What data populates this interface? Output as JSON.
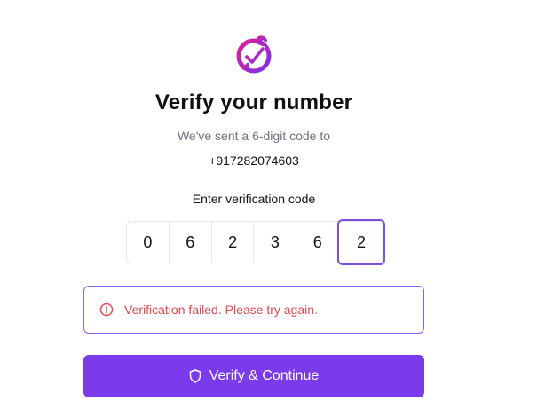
{
  "header": {
    "logo_icon": "wrench-check-logo-icon",
    "title": "Verify your number",
    "subtitle": "We've sent a 6-digit code to",
    "phone_number": "+917282074603"
  },
  "verification": {
    "label": "Enter verification code",
    "digits": [
      "0",
      "6",
      "2",
      "3",
      "6",
      "2"
    ],
    "active_index": 5
  },
  "error": {
    "icon": "alert-circle-icon",
    "message": "Verification failed. Please try again.",
    "color": "#e5484d",
    "border_color": "#8b5cf6"
  },
  "actions": {
    "verify_label": "Verify & Continue",
    "verify_icon": "shield-icon",
    "accent_color": "#7c3aed"
  }
}
